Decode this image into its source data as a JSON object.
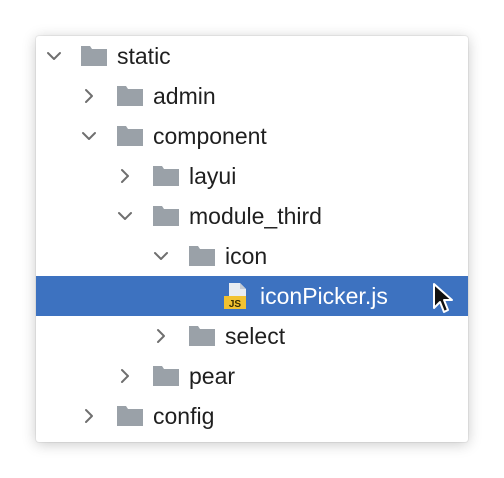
{
  "tree": {
    "items": [
      {
        "label": "static",
        "icon": "folder-icon",
        "state": "expanded"
      },
      {
        "label": "admin",
        "icon": "folder-icon",
        "state": "collapsed"
      },
      {
        "label": "component",
        "icon": "folder-icon",
        "state": "expanded"
      },
      {
        "label": "layui",
        "icon": "folder-icon",
        "state": "collapsed"
      },
      {
        "label": "module_third",
        "icon": "folder-icon",
        "state": "expanded"
      },
      {
        "label": "icon",
        "icon": "folder-icon",
        "state": "expanded"
      },
      {
        "label": "iconPicker.js",
        "icon": "javascript-file-icon",
        "badge": "JS",
        "state": "selected"
      },
      {
        "label": "select",
        "icon": "folder-icon",
        "state": "collapsed"
      },
      {
        "label": "pear",
        "icon": "folder-icon",
        "state": "collapsed"
      },
      {
        "label": "config",
        "icon": "folder-icon",
        "state": "collapsed"
      }
    ]
  },
  "colors": {
    "selection": "#3d72c0",
    "folder": "#9aa1a8",
    "js_badge": "#f2c230",
    "text": "#1f1f1f",
    "chevron": "#6f6f6f"
  }
}
